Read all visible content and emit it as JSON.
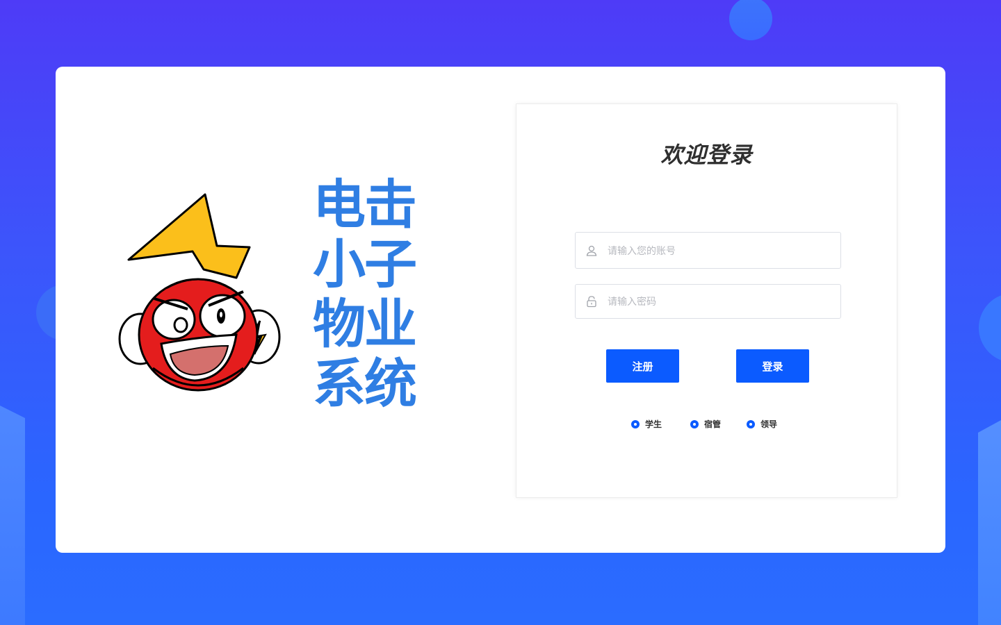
{
  "brand": {
    "system_name_lines": [
      "电击",
      "小子",
      "物业",
      "系统"
    ]
  },
  "login": {
    "title": "欢迎登录",
    "account_placeholder": "请输入您的账号",
    "password_placeholder": "请输入密码",
    "register_label": "注册",
    "login_label": "登录",
    "roles": [
      "学生",
      "宿管",
      "领导"
    ]
  },
  "icons": {
    "account": "user-icon",
    "password": "lock-icon"
  },
  "colors": {
    "primary": "#0b5bff",
    "brand_text": "#2f7ee3",
    "background": "#4e3bf7"
  }
}
